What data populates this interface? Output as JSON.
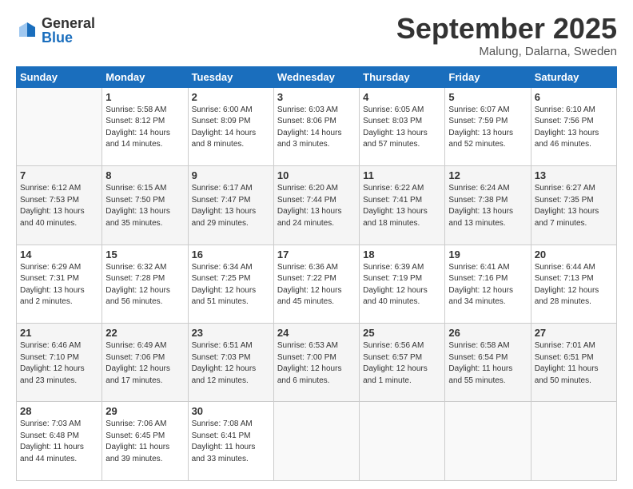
{
  "logo": {
    "general": "General",
    "blue": "Blue"
  },
  "header": {
    "month": "September 2025",
    "location": "Malung, Dalarna, Sweden"
  },
  "weekdays": [
    "Sunday",
    "Monday",
    "Tuesday",
    "Wednesday",
    "Thursday",
    "Friday",
    "Saturday"
  ],
  "weeks": [
    [
      {
        "day": "",
        "info": ""
      },
      {
        "day": "1",
        "info": "Sunrise: 5:58 AM\nSunset: 8:12 PM\nDaylight: 14 hours\nand 14 minutes."
      },
      {
        "day": "2",
        "info": "Sunrise: 6:00 AM\nSunset: 8:09 PM\nDaylight: 14 hours\nand 8 minutes."
      },
      {
        "day": "3",
        "info": "Sunrise: 6:03 AM\nSunset: 8:06 PM\nDaylight: 14 hours\nand 3 minutes."
      },
      {
        "day": "4",
        "info": "Sunrise: 6:05 AM\nSunset: 8:03 PM\nDaylight: 13 hours\nand 57 minutes."
      },
      {
        "day": "5",
        "info": "Sunrise: 6:07 AM\nSunset: 7:59 PM\nDaylight: 13 hours\nand 52 minutes."
      },
      {
        "day": "6",
        "info": "Sunrise: 6:10 AM\nSunset: 7:56 PM\nDaylight: 13 hours\nand 46 minutes."
      }
    ],
    [
      {
        "day": "7",
        "info": "Sunrise: 6:12 AM\nSunset: 7:53 PM\nDaylight: 13 hours\nand 40 minutes."
      },
      {
        "day": "8",
        "info": "Sunrise: 6:15 AM\nSunset: 7:50 PM\nDaylight: 13 hours\nand 35 minutes."
      },
      {
        "day": "9",
        "info": "Sunrise: 6:17 AM\nSunset: 7:47 PM\nDaylight: 13 hours\nand 29 minutes."
      },
      {
        "day": "10",
        "info": "Sunrise: 6:20 AM\nSunset: 7:44 PM\nDaylight: 13 hours\nand 24 minutes."
      },
      {
        "day": "11",
        "info": "Sunrise: 6:22 AM\nSunset: 7:41 PM\nDaylight: 13 hours\nand 18 minutes."
      },
      {
        "day": "12",
        "info": "Sunrise: 6:24 AM\nSunset: 7:38 PM\nDaylight: 13 hours\nand 13 minutes."
      },
      {
        "day": "13",
        "info": "Sunrise: 6:27 AM\nSunset: 7:35 PM\nDaylight: 13 hours\nand 7 minutes."
      }
    ],
    [
      {
        "day": "14",
        "info": "Sunrise: 6:29 AM\nSunset: 7:31 PM\nDaylight: 13 hours\nand 2 minutes."
      },
      {
        "day": "15",
        "info": "Sunrise: 6:32 AM\nSunset: 7:28 PM\nDaylight: 12 hours\nand 56 minutes."
      },
      {
        "day": "16",
        "info": "Sunrise: 6:34 AM\nSunset: 7:25 PM\nDaylight: 12 hours\nand 51 minutes."
      },
      {
        "day": "17",
        "info": "Sunrise: 6:36 AM\nSunset: 7:22 PM\nDaylight: 12 hours\nand 45 minutes."
      },
      {
        "day": "18",
        "info": "Sunrise: 6:39 AM\nSunset: 7:19 PM\nDaylight: 12 hours\nand 40 minutes."
      },
      {
        "day": "19",
        "info": "Sunrise: 6:41 AM\nSunset: 7:16 PM\nDaylight: 12 hours\nand 34 minutes."
      },
      {
        "day": "20",
        "info": "Sunrise: 6:44 AM\nSunset: 7:13 PM\nDaylight: 12 hours\nand 28 minutes."
      }
    ],
    [
      {
        "day": "21",
        "info": "Sunrise: 6:46 AM\nSunset: 7:10 PM\nDaylight: 12 hours\nand 23 minutes."
      },
      {
        "day": "22",
        "info": "Sunrise: 6:49 AM\nSunset: 7:06 PM\nDaylight: 12 hours\nand 17 minutes."
      },
      {
        "day": "23",
        "info": "Sunrise: 6:51 AM\nSunset: 7:03 PM\nDaylight: 12 hours\nand 12 minutes."
      },
      {
        "day": "24",
        "info": "Sunrise: 6:53 AM\nSunset: 7:00 PM\nDaylight: 12 hours\nand 6 minutes."
      },
      {
        "day": "25",
        "info": "Sunrise: 6:56 AM\nSunset: 6:57 PM\nDaylight: 12 hours\nand 1 minute."
      },
      {
        "day": "26",
        "info": "Sunrise: 6:58 AM\nSunset: 6:54 PM\nDaylight: 11 hours\nand 55 minutes."
      },
      {
        "day": "27",
        "info": "Sunrise: 7:01 AM\nSunset: 6:51 PM\nDaylight: 11 hours\nand 50 minutes."
      }
    ],
    [
      {
        "day": "28",
        "info": "Sunrise: 7:03 AM\nSunset: 6:48 PM\nDaylight: 11 hours\nand 44 minutes."
      },
      {
        "day": "29",
        "info": "Sunrise: 7:06 AM\nSunset: 6:45 PM\nDaylight: 11 hours\nand 39 minutes."
      },
      {
        "day": "30",
        "info": "Sunrise: 7:08 AM\nSunset: 6:41 PM\nDaylight: 11 hours\nand 33 minutes."
      },
      {
        "day": "",
        "info": ""
      },
      {
        "day": "",
        "info": ""
      },
      {
        "day": "",
        "info": ""
      },
      {
        "day": "",
        "info": ""
      }
    ]
  ]
}
